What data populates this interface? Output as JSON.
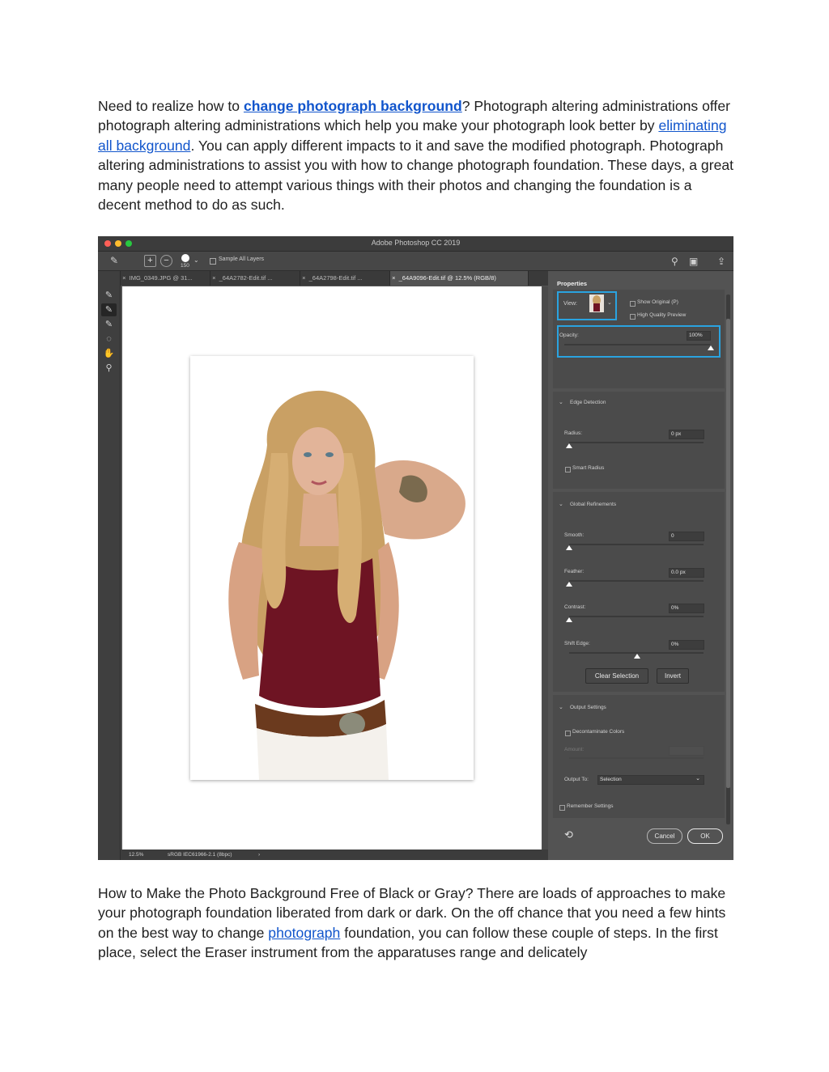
{
  "paragraph1": {
    "before_link1": "Need to realize how to ",
    "link1": "change photograph background",
    "after_link1": "? Photograph altering administrations offer photograph altering administrations which help you make your photograph look better by ",
    "link2": "eliminating all background",
    "after_link2": ". You can apply different impacts to it and save the modified photograph. Photograph altering administrations to assist you with how to change photograph foundation. These days, a great many people need to attempt various things with their photos and changing the foundation is a decent method to do as such."
  },
  "paragraph2": {
    "before_link": "How to Make the Photo Background Free of Black or Gray? There are loads of approaches to make your photograph foundation liberated from dark or dark. On the off chance that you need a few hints on the best way to change ",
    "link": "photograph",
    "after_link": " foundation, you can follow these couple of steps. In the first place, select the Eraser instrument from the apparatuses range and delicately"
  },
  "photoshop": {
    "window_title": "Adobe Photoshop CC 2019",
    "options_bar": {
      "brush_size": "150",
      "sample_all_layers": "Sample All Layers"
    },
    "doc_tabs": [
      "IMG_0349.JPG @ 31...",
      "_64A2782-Edit.tif ...",
      "_64A2798-Edit.tif ...",
      "_64A9096-Edit.tif @ 12.5% (RGB/8)"
    ],
    "status_bar": {
      "zoom": "12.5%",
      "profile": "sRGB IEC61966-2.1 (8bpc)"
    },
    "properties": {
      "tab_title": "Properties",
      "view_label": "View:",
      "show_original": "Show Original (P)",
      "high_quality_preview": "High Quality Preview",
      "opacity_label": "Opacity:",
      "opacity_value": "100%",
      "edge_detection": {
        "title": "Edge Detection",
        "radius_label": "Radius:",
        "radius_value": "0 px",
        "smart_radius": "Smart Radius"
      },
      "global_refinements": {
        "title": "Global Refinements",
        "smooth_label": "Smooth:",
        "smooth_value": "0",
        "feather_label": "Feather:",
        "feather_value": "0.0 px",
        "contrast_label": "Contrast:",
        "contrast_value": "0%",
        "shift_edge_label": "Shift Edge:",
        "shift_edge_value": "0%",
        "clear_selection": "Clear Selection",
        "invert": "Invert"
      },
      "output_settings": {
        "title": "Output Settings",
        "decontaminate_colors": "Decontaminate Colors",
        "amount_label": "Amount:",
        "output_to_label": "Output To:",
        "output_to_value": "Selection",
        "remember_settings": "Remember Settings"
      },
      "cancel": "Cancel",
      "ok": "OK"
    },
    "colors": {
      "link": "#1155cc",
      "highlight": "#2aa3e0",
      "panel_bg": "#535353",
      "shirt": "#6e1423",
      "hair": "#c9a064"
    },
    "icons": [
      "brush-icon",
      "add-brush-icon",
      "subtract-brush-icon",
      "search-icon",
      "window-icon",
      "share-icon",
      "quick-selection-icon",
      "refine-edge-icon",
      "lasso-icon",
      "hand-icon",
      "zoom-icon",
      "reset-icon"
    ]
  }
}
